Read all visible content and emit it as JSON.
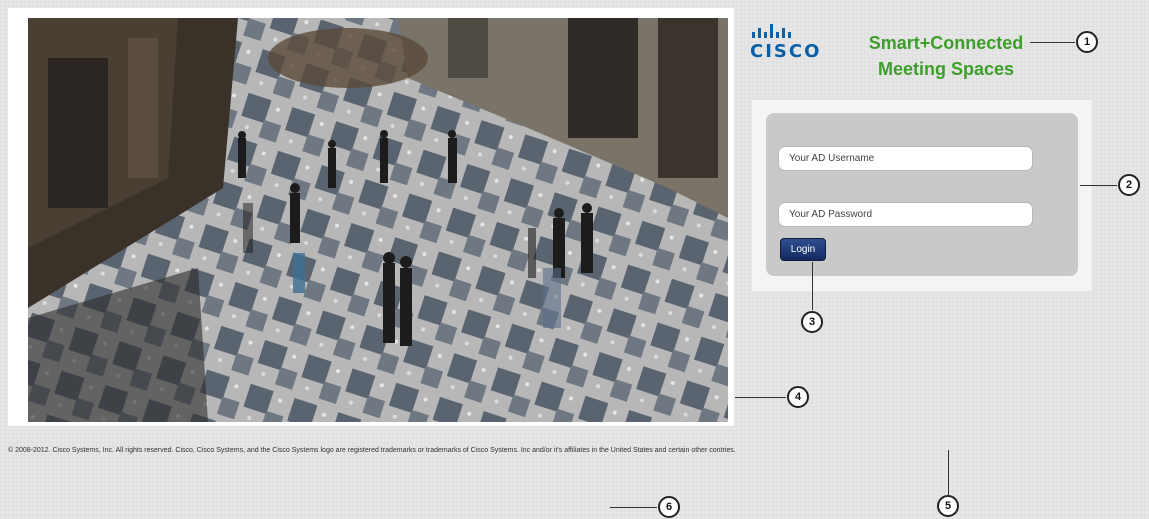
{
  "branding": {
    "logo_word": "CISCO",
    "title_line1": "Smart+Connected",
    "title_line2": "Meeting Spaces",
    "accent_color": "#3d9f2a",
    "logo_color": "#0a5fa6"
  },
  "login": {
    "username_placeholder": "Your AD Username",
    "password_placeholder": "Your AD Password",
    "login_label": "Login"
  },
  "footer": {
    "copyright": "© 2008-2012. Cisco Systems, Inc. All rights reserved. Cisco, Cisco Systems, and the Cisco Systems logo are registered trademarks or trademarks of Cisco Systems. Inc and/or it's affiliates in the United States and certain other contries."
  },
  "callouts": [
    "1",
    "2",
    "3",
    "4",
    "5",
    "6"
  ],
  "background_image": "plaza-photo"
}
